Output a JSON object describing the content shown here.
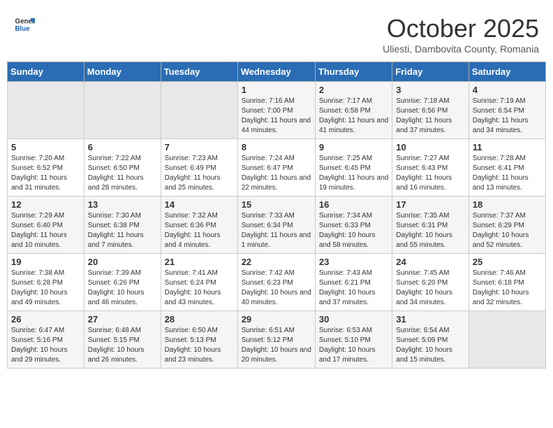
{
  "header": {
    "logo_general": "General",
    "logo_blue": "Blue",
    "month": "October 2025",
    "location": "Uliesti, Dambovita County, Romania"
  },
  "weekdays": [
    "Sunday",
    "Monday",
    "Tuesday",
    "Wednesday",
    "Thursday",
    "Friday",
    "Saturday"
  ],
  "weeks": [
    [
      {
        "day": "",
        "info": ""
      },
      {
        "day": "",
        "info": ""
      },
      {
        "day": "",
        "info": ""
      },
      {
        "day": "1",
        "info": "Sunrise: 7:16 AM\nSunset: 7:00 PM\nDaylight: 11 hours and 44 minutes."
      },
      {
        "day": "2",
        "info": "Sunrise: 7:17 AM\nSunset: 6:58 PM\nDaylight: 11 hours and 41 minutes."
      },
      {
        "day": "3",
        "info": "Sunrise: 7:18 AM\nSunset: 6:56 PM\nDaylight: 11 hours and 37 minutes."
      },
      {
        "day": "4",
        "info": "Sunrise: 7:19 AM\nSunset: 6:54 PM\nDaylight: 11 hours and 34 minutes."
      }
    ],
    [
      {
        "day": "5",
        "info": "Sunrise: 7:20 AM\nSunset: 6:52 PM\nDaylight: 11 hours and 31 minutes."
      },
      {
        "day": "6",
        "info": "Sunrise: 7:22 AM\nSunset: 6:50 PM\nDaylight: 11 hours and 28 minutes."
      },
      {
        "day": "7",
        "info": "Sunrise: 7:23 AM\nSunset: 6:49 PM\nDaylight: 11 hours and 25 minutes."
      },
      {
        "day": "8",
        "info": "Sunrise: 7:24 AM\nSunset: 6:47 PM\nDaylight: 11 hours and 22 minutes."
      },
      {
        "day": "9",
        "info": "Sunrise: 7:25 AM\nSunset: 6:45 PM\nDaylight: 11 hours and 19 minutes."
      },
      {
        "day": "10",
        "info": "Sunrise: 7:27 AM\nSunset: 6:43 PM\nDaylight: 11 hours and 16 minutes."
      },
      {
        "day": "11",
        "info": "Sunrise: 7:28 AM\nSunset: 6:41 PM\nDaylight: 11 hours and 13 minutes."
      }
    ],
    [
      {
        "day": "12",
        "info": "Sunrise: 7:29 AM\nSunset: 6:40 PM\nDaylight: 11 hours and 10 minutes."
      },
      {
        "day": "13",
        "info": "Sunrise: 7:30 AM\nSunset: 6:38 PM\nDaylight: 11 hours and 7 minutes."
      },
      {
        "day": "14",
        "info": "Sunrise: 7:32 AM\nSunset: 6:36 PM\nDaylight: 11 hours and 4 minutes."
      },
      {
        "day": "15",
        "info": "Sunrise: 7:33 AM\nSunset: 6:34 PM\nDaylight: 11 hours and 1 minute."
      },
      {
        "day": "16",
        "info": "Sunrise: 7:34 AM\nSunset: 6:33 PM\nDaylight: 10 hours and 58 minutes."
      },
      {
        "day": "17",
        "info": "Sunrise: 7:35 AM\nSunset: 6:31 PM\nDaylight: 10 hours and 55 minutes."
      },
      {
        "day": "18",
        "info": "Sunrise: 7:37 AM\nSunset: 6:29 PM\nDaylight: 10 hours and 52 minutes."
      }
    ],
    [
      {
        "day": "19",
        "info": "Sunrise: 7:38 AM\nSunset: 6:28 PM\nDaylight: 10 hours and 49 minutes."
      },
      {
        "day": "20",
        "info": "Sunrise: 7:39 AM\nSunset: 6:26 PM\nDaylight: 10 hours and 46 minutes."
      },
      {
        "day": "21",
        "info": "Sunrise: 7:41 AM\nSunset: 6:24 PM\nDaylight: 10 hours and 43 minutes."
      },
      {
        "day": "22",
        "info": "Sunrise: 7:42 AM\nSunset: 6:23 PM\nDaylight: 10 hours and 40 minutes."
      },
      {
        "day": "23",
        "info": "Sunrise: 7:43 AM\nSunset: 6:21 PM\nDaylight: 10 hours and 37 minutes."
      },
      {
        "day": "24",
        "info": "Sunrise: 7:45 AM\nSunset: 6:20 PM\nDaylight: 10 hours and 34 minutes."
      },
      {
        "day": "25",
        "info": "Sunrise: 7:46 AM\nSunset: 6:18 PM\nDaylight: 10 hours and 32 minutes."
      }
    ],
    [
      {
        "day": "26",
        "info": "Sunrise: 6:47 AM\nSunset: 5:16 PM\nDaylight: 10 hours and 29 minutes."
      },
      {
        "day": "27",
        "info": "Sunrise: 6:48 AM\nSunset: 5:15 PM\nDaylight: 10 hours and 26 minutes."
      },
      {
        "day": "28",
        "info": "Sunrise: 6:50 AM\nSunset: 5:13 PM\nDaylight: 10 hours and 23 minutes."
      },
      {
        "day": "29",
        "info": "Sunrise: 6:51 AM\nSunset: 5:12 PM\nDaylight: 10 hours and 20 minutes."
      },
      {
        "day": "30",
        "info": "Sunrise: 6:53 AM\nSunset: 5:10 PM\nDaylight: 10 hours and 17 minutes."
      },
      {
        "day": "31",
        "info": "Sunrise: 6:54 AM\nSunset: 5:09 PM\nDaylight: 10 hours and 15 minutes."
      },
      {
        "day": "",
        "info": ""
      }
    ]
  ]
}
